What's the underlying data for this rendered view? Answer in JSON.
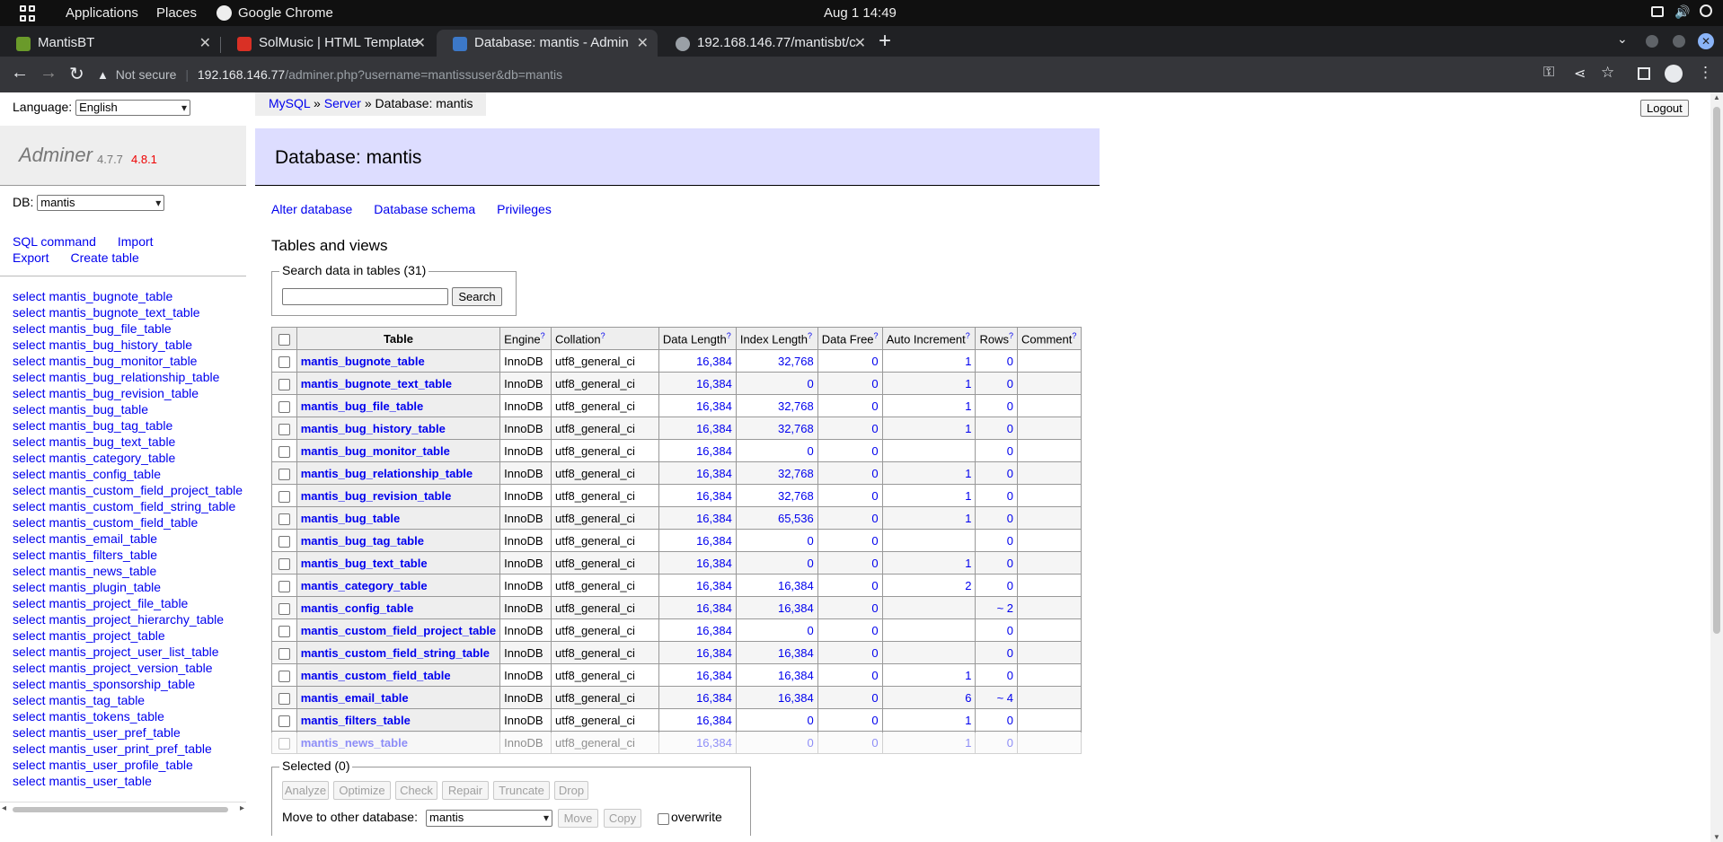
{
  "gnome": {
    "applications": "Applications",
    "places": "Places",
    "active_app": "Google Chrome",
    "clock": "Aug 1  14:49"
  },
  "browser": {
    "tabs": [
      {
        "title": "MantisBT",
        "favicon_color": "#6a9a2a"
      },
      {
        "title": "SolMusic | HTML Template",
        "favicon_color": "#d93025"
      },
      {
        "title": "Database: mantis - Admin",
        "favicon_color": "#3c78c8"
      },
      {
        "title": "192.168.146.77/mantisbt/c",
        "favicon_color": "#9aa0a6"
      }
    ],
    "new_tab": "+",
    "security": "Not secure",
    "url_host": "192.168.146.77",
    "url_path": "/adminer.php?username=mantissuser&db=mantis"
  },
  "menu": {
    "language_label": "Language:",
    "language_value": "English",
    "app_name": "Adminer",
    "version": "4.7.7",
    "new_version": "4.8.1",
    "db_label": "DB:",
    "db_value": "mantis",
    "sql_command": "SQL command",
    "import": "Import",
    "export": "Export",
    "create_table": "Create table",
    "select_prefix": "select",
    "tables": [
      "mantis_bugnote_table",
      "mantis_bugnote_text_table",
      "mantis_bug_file_table",
      "mantis_bug_history_table",
      "mantis_bug_monitor_table",
      "mantis_bug_relationship_table",
      "mantis_bug_revision_table",
      "mantis_bug_table",
      "mantis_bug_tag_table",
      "mantis_bug_text_table",
      "mantis_category_table",
      "mantis_config_table",
      "mantis_custom_field_project_table",
      "mantis_custom_field_string_table",
      "mantis_custom_field_table",
      "mantis_email_table",
      "mantis_filters_table",
      "mantis_news_table",
      "mantis_plugin_table",
      "mantis_project_file_table",
      "mantis_project_hierarchy_table",
      "mantis_project_table",
      "mantis_project_user_list_table",
      "mantis_project_version_table",
      "mantis_sponsorship_table",
      "mantis_tag_table",
      "mantis_tokens_table",
      "mantis_user_pref_table",
      "mantis_user_print_pref_table",
      "mantis_user_profile_table",
      "mantis_user_table"
    ]
  },
  "content": {
    "breadcrumb": {
      "mysql": "MySQL",
      "sep": "»",
      "server": "Server",
      "current": "Database: mantis"
    },
    "logout": "Logout",
    "heading": "Database: mantis",
    "links": {
      "alter": "Alter database",
      "schema": "Database schema",
      "privileges": "Privileges"
    },
    "section_title": "Tables and views",
    "search_legend": "Search data in tables (31)",
    "search_button": "Search",
    "columns": [
      "Table",
      "Engine",
      "Collation",
      "Data Length",
      "Index Length",
      "Data Free",
      "Auto Increment",
      "Rows",
      "Comment"
    ],
    "help_mark": "?",
    "rows": [
      [
        "mantis_bugnote_table",
        "InnoDB",
        "utf8_general_ci",
        "16,384",
        "32,768",
        "0",
        "1",
        "0",
        ""
      ],
      [
        "mantis_bugnote_text_table",
        "InnoDB",
        "utf8_general_ci",
        "16,384",
        "0",
        "0",
        "1",
        "0",
        ""
      ],
      [
        "mantis_bug_file_table",
        "InnoDB",
        "utf8_general_ci",
        "16,384",
        "32,768",
        "0",
        "1",
        "0",
        ""
      ],
      [
        "mantis_bug_history_table",
        "InnoDB",
        "utf8_general_ci",
        "16,384",
        "32,768",
        "0",
        "1",
        "0",
        ""
      ],
      [
        "mantis_bug_monitor_table",
        "InnoDB",
        "utf8_general_ci",
        "16,384",
        "0",
        "0",
        "",
        "0",
        ""
      ],
      [
        "mantis_bug_relationship_table",
        "InnoDB",
        "utf8_general_ci",
        "16,384",
        "32,768",
        "0",
        "1",
        "0",
        ""
      ],
      [
        "mantis_bug_revision_table",
        "InnoDB",
        "utf8_general_ci",
        "16,384",
        "32,768",
        "0",
        "1",
        "0",
        ""
      ],
      [
        "mantis_bug_table",
        "InnoDB",
        "utf8_general_ci",
        "16,384",
        "65,536",
        "0",
        "1",
        "0",
        ""
      ],
      [
        "mantis_bug_tag_table",
        "InnoDB",
        "utf8_general_ci",
        "16,384",
        "0",
        "0",
        "",
        "0",
        ""
      ],
      [
        "mantis_bug_text_table",
        "InnoDB",
        "utf8_general_ci",
        "16,384",
        "0",
        "0",
        "1",
        "0",
        ""
      ],
      [
        "mantis_category_table",
        "InnoDB",
        "utf8_general_ci",
        "16,384",
        "16,384",
        "0",
        "2",
        "0",
        ""
      ],
      [
        "mantis_config_table",
        "InnoDB",
        "utf8_general_ci",
        "16,384",
        "16,384",
        "0",
        "",
        "~ 2",
        ""
      ],
      [
        "mantis_custom_field_project_table",
        "InnoDB",
        "utf8_general_ci",
        "16,384",
        "0",
        "0",
        "",
        "0",
        ""
      ],
      [
        "mantis_custom_field_string_table",
        "InnoDB",
        "utf8_general_ci",
        "16,384",
        "16,384",
        "0",
        "",
        "0",
        ""
      ],
      [
        "mantis_custom_field_table",
        "InnoDB",
        "utf8_general_ci",
        "16,384",
        "16,384",
        "0",
        "1",
        "0",
        ""
      ],
      [
        "mantis_email_table",
        "InnoDB",
        "utf8_general_ci",
        "16,384",
        "16,384",
        "0",
        "6",
        "~ 4",
        ""
      ],
      [
        "mantis_filters_table",
        "InnoDB",
        "utf8_general_ci",
        "16,384",
        "0",
        "0",
        "1",
        "0",
        ""
      ],
      [
        "mantis_news_table",
        "InnoDB",
        "utf8_general_ci",
        "16,384",
        "0",
        "0",
        "1",
        "0",
        ""
      ]
    ],
    "selected_legend": "Selected (0)",
    "actions": [
      "Analyze",
      "Optimize",
      "Check",
      "Repair",
      "Truncate",
      "Drop"
    ],
    "move_label": "Move to other database:",
    "move_db": "mantis",
    "move_button": "Move",
    "copy_button": "Copy",
    "overwrite": "overwrite"
  }
}
